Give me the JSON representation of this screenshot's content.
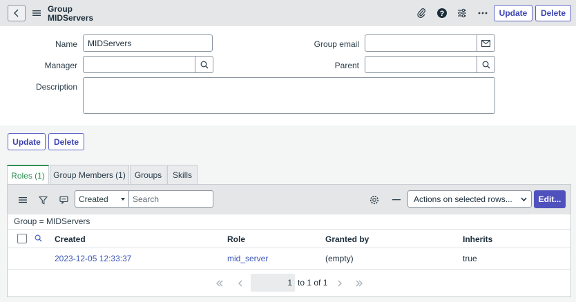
{
  "header": {
    "title_line1": "Group",
    "title_line2": "MIDServers",
    "update_label": "Update",
    "delete_label": "Delete"
  },
  "form": {
    "name_label": "Name",
    "name_value": "MIDServers",
    "manager_label": "Manager",
    "manager_value": "",
    "description_label": "Description",
    "description_value": "",
    "group_email_label": "Group email",
    "group_email_value": "",
    "parent_label": "Parent",
    "parent_value": ""
  },
  "form_buttons": {
    "update_label": "Update",
    "delete_label": "Delete"
  },
  "tabs": [
    {
      "label": "Roles (1)",
      "active": true
    },
    {
      "label": "Group Members (1)",
      "active": false
    },
    {
      "label": "Groups",
      "active": false
    },
    {
      "label": "Skills",
      "active": false
    }
  ],
  "list": {
    "search_field_selected": "Created",
    "search_placeholder": "Search",
    "actions_selected": "Actions on selected rows...",
    "edit_label": "Edit...",
    "breadcrumb": "Group = MIDServers",
    "columns": [
      "Created",
      "Role",
      "Granted by",
      "Inherits"
    ],
    "rows": [
      {
        "created": "2023-12-05 12:33:37",
        "role": "mid_server",
        "granted_by": "(empty)",
        "inherits": "true"
      }
    ],
    "pager": {
      "current": "1",
      "range_text": "to 1 of 1"
    }
  },
  "colors": {
    "primary_button": "#4f52bd",
    "active_tab": "#2e8f54",
    "link": "#3b55b8"
  }
}
